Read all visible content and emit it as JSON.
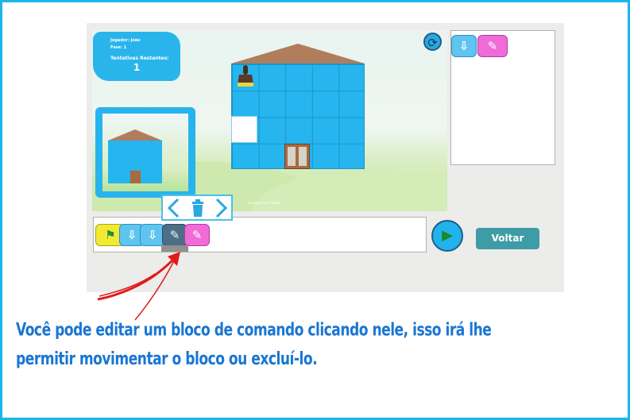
{
  "game": {
    "player_label": "Jogador: João",
    "phase_label": "Fase: 1",
    "attempts_label": "Tentativas Restantes:",
    "attempts_value": "1",
    "credit_text": "Designed by Freepik"
  },
  "toolbar": {
    "reset_icon": "reset-icon",
    "play_icon": "play-icon",
    "back_label": "Voltar"
  },
  "edit_popup": {
    "left_icon": "chevron-left-icon",
    "trash_icon": "trash-icon",
    "right_icon": "chevron-right-icon"
  },
  "program_blocks": [
    "flag-icon",
    "arrow-down-icon",
    "arrow-down-icon",
    "pencil-icon",
    "paint-icon"
  ],
  "solution_blocks": [
    "arrow-down-icon",
    "paint-icon"
  ],
  "caption": {
    "line1": "Você pode editar um bloco de comando clicando nele, isso irá lhe",
    "line2": "permitir movimentar o bloco ou excluí-lo."
  },
  "colors": {
    "frame": "#1bb6e8",
    "house_wall": "#26b5ee",
    "roof": "#b07d5d",
    "caption_text": "#1a76d2",
    "arrow": "#e01b1b",
    "back_button": "#3e9ca6"
  }
}
